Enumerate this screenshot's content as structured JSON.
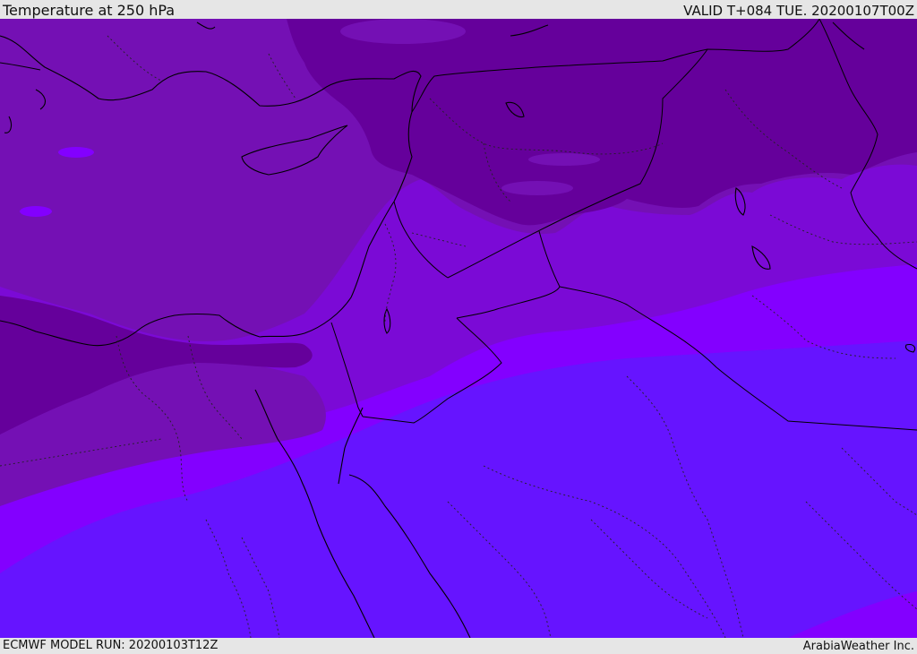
{
  "header": {
    "title": "Temperature at 250 hPa",
    "valid": "VALID T+084 TUE. 20200107T00Z"
  },
  "footer": {
    "model_run": "ECMWF MODEL RUN: 20200103T12Z",
    "credit": "ArabiaWeather Inc."
  },
  "colors": {
    "band_darkest": "#65009b",
    "band_dark": "#7410b4",
    "band_mid": "#7b0ad6",
    "band_bright": "#8300ff",
    "band_blue": "#6614ff",
    "border_line": "#000000"
  }
}
